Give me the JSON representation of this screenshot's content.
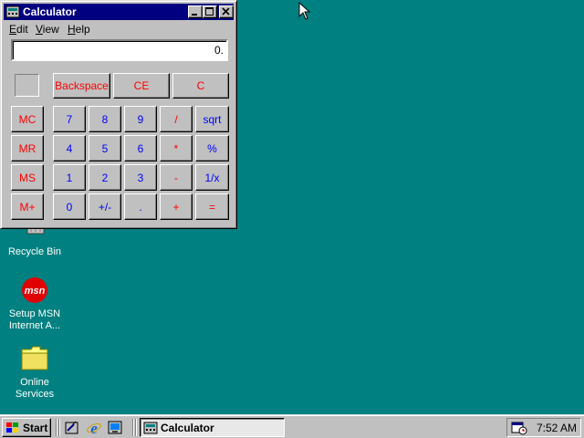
{
  "window": {
    "title": "Calculator",
    "menu": [
      {
        "label": "Edit",
        "key": "E"
      },
      {
        "label": "View",
        "key": "V"
      },
      {
        "label": "Help",
        "key": "H"
      }
    ],
    "display_value": "0."
  },
  "buttons": {
    "backspace": "Backspace",
    "ce": "CE",
    "c": "C",
    "mc": "MC",
    "mr": "MR",
    "ms": "MS",
    "mplus": "M+",
    "d7": "7",
    "d8": "8",
    "d9": "9",
    "div": "/",
    "sqrt": "sqrt",
    "d4": "4",
    "d5": "5",
    "d6": "6",
    "mul": "*",
    "pct": "%",
    "d1": "1",
    "d2": "2",
    "d3": "3",
    "sub": "-",
    "inv": "1/x",
    "d0": "0",
    "sign": "+/-",
    "dot": ".",
    "add": "+",
    "eq": "="
  },
  "desktop_icons": {
    "recycle_bin": "Recycle Bin",
    "msn_line1": "Setup MSN",
    "msn_line2": "Internet A...",
    "msn_logo": "msn",
    "online_line1": "Online",
    "online_line2": "Services"
  },
  "taskbar": {
    "start_label": "Start",
    "task_label": "Calculator",
    "clock": "7:52 AM"
  },
  "colors": {
    "desktop": "#008080",
    "titlebar": "#000080",
    "red_keys": "#ff0000",
    "blue_keys": "#0000ff"
  }
}
